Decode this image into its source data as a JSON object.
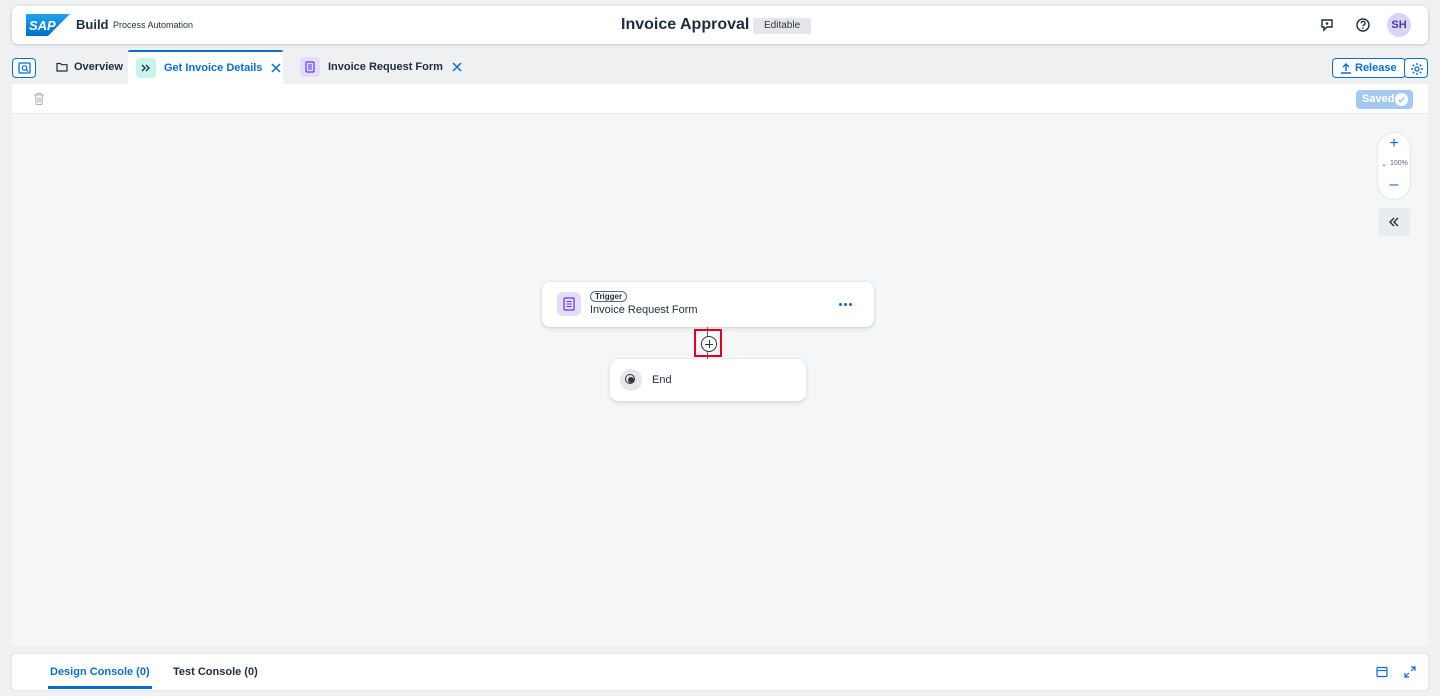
{
  "shell": {
    "brand": "Build",
    "product": "Process Automation",
    "title": "Invoice Approval",
    "status": "Editable",
    "user_initials": "SH"
  },
  "tabs": [
    {
      "label": "Overview",
      "icon": "folder-icon"
    },
    {
      "label": "Get Invoice Details",
      "icon": "process-icon",
      "active": true
    },
    {
      "label": "Invoice Request Form",
      "icon": "form-icon"
    }
  ],
  "actions": {
    "release": "Release",
    "saved": "Saved"
  },
  "zoom": {
    "level": "100%"
  },
  "canvas": {
    "trigger_chip": "Trigger",
    "trigger_title": "Invoice Request Form",
    "end_label": "End"
  },
  "console": {
    "design": "Design Console (0)",
    "test": "Test Console (0)"
  },
  "colors": {
    "accent": "#0a6ed1",
    "highlight": "#e0001b",
    "form_tint": "#e4dcf9",
    "process_tint": "#c8f4ee"
  }
}
